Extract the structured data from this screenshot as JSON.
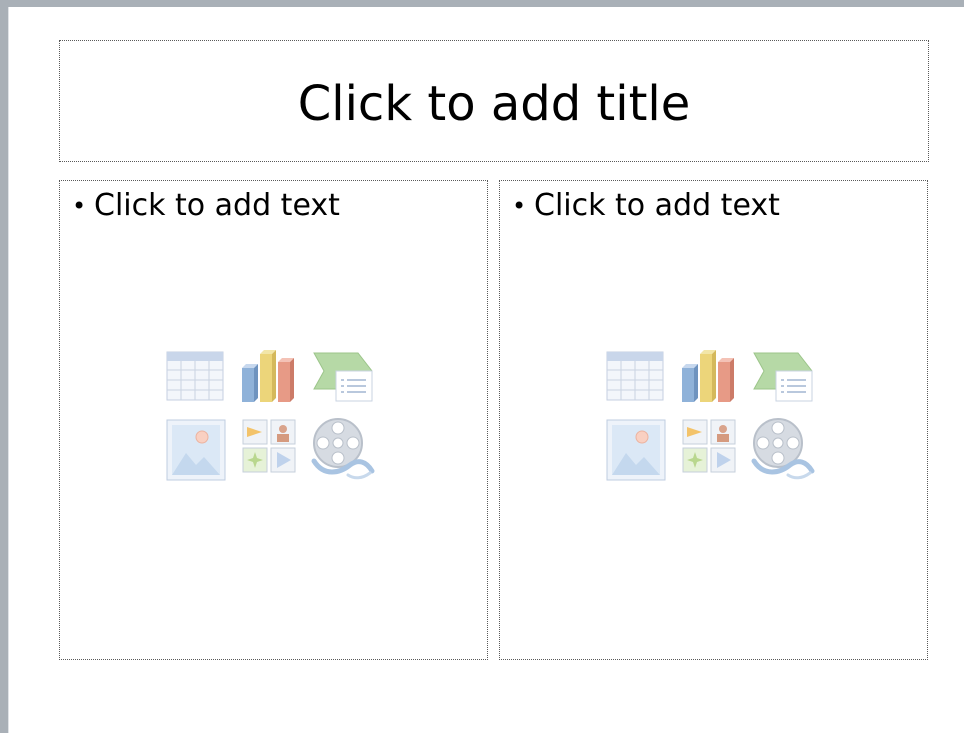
{
  "slide": {
    "title_placeholder": "Click to add title",
    "content_placeholders": [
      {
        "bullet_text": "Click to add text"
      },
      {
        "bullet_text": "Click to add text"
      }
    ],
    "insert_icons": [
      "insert-table-icon",
      "insert-chart-icon",
      "insert-smartart-icon",
      "insert-picture-icon",
      "insert-clip-art-icon",
      "insert-media-clip-icon"
    ]
  }
}
